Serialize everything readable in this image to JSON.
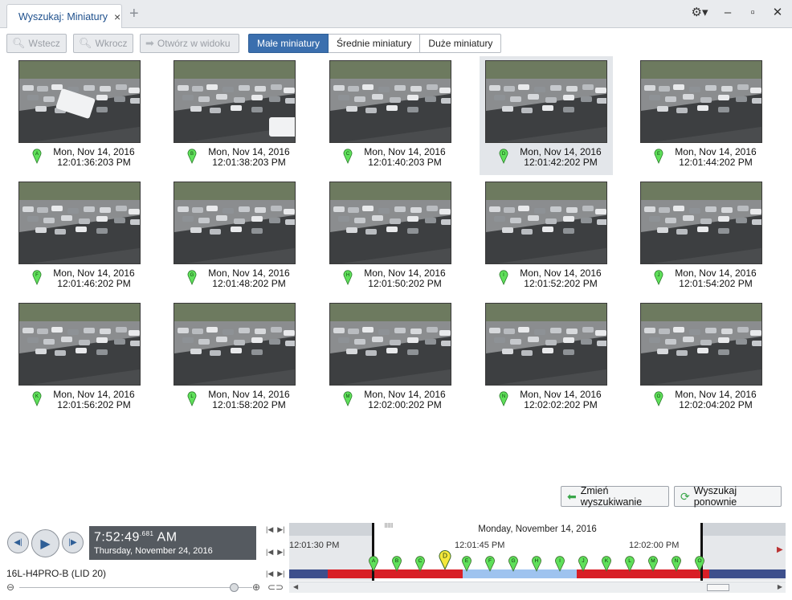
{
  "window": {
    "tab_title": "Wyszukaj: Miniatury",
    "tab_close": "×",
    "tab_add": "+"
  },
  "toolbar": {
    "back_label": "Wstecz",
    "forward_label": "Wkrocz",
    "open_in_view_label": "Otwórz w widoku",
    "size_small": "Małe miniatury",
    "size_medium": "Średnie miniatury",
    "size_large": "Duże miniatury",
    "selected_size": "Małe miniatury"
  },
  "thumbnails": [
    {
      "letter": "A",
      "date": "Mon, Nov 14, 2016",
      "time": "12:01:36:203 PM",
      "selected": false
    },
    {
      "letter": "B",
      "date": "Mon, Nov 14, 2016",
      "time": "12:01:38:203 PM",
      "selected": false
    },
    {
      "letter": "C",
      "date": "Mon, Nov 14, 2016",
      "time": "12:01:40:203 PM",
      "selected": false
    },
    {
      "letter": "D",
      "date": "Mon, Nov 14, 2016",
      "time": "12:01:42:202 PM",
      "selected": true
    },
    {
      "letter": "E",
      "date": "Mon, Nov 14, 2016",
      "time": "12:01:44:202 PM",
      "selected": false
    },
    {
      "letter": "F",
      "date": "Mon, Nov 14, 2016",
      "time": "12:01:46:202 PM",
      "selected": false
    },
    {
      "letter": "G",
      "date": "Mon, Nov 14, 2016",
      "time": "12:01:48:202 PM",
      "selected": false
    },
    {
      "letter": "H",
      "date": "Mon, Nov 14, 2016",
      "time": "12:01:50:202 PM",
      "selected": false
    },
    {
      "letter": "I",
      "date": "Mon, Nov 14, 2016",
      "time": "12:01:52:202 PM",
      "selected": false
    },
    {
      "letter": "J",
      "date": "Mon, Nov 14, 2016",
      "time": "12:01:54:202 PM",
      "selected": false
    },
    {
      "letter": "K",
      "date": "Mon, Nov 14, 2016",
      "time": "12:01:56:202 PM",
      "selected": false
    },
    {
      "letter": "L",
      "date": "Mon, Nov 14, 2016",
      "time": "12:01:58:202 PM",
      "selected": false
    },
    {
      "letter": "M",
      "date": "Mon, Nov 14, 2016",
      "time": "12:02:00:202 PM",
      "selected": false
    },
    {
      "letter": "N",
      "date": "Mon, Nov 14, 2016",
      "time": "12:02:02:202 PM",
      "selected": false
    },
    {
      "letter": "O",
      "date": "Mon, Nov 14, 2016",
      "time": "12:02:04:202 PM",
      "selected": false
    }
  ],
  "actions": {
    "modify_search_label": "Zmień wyszukiwanie",
    "search_again_label": "Wyszukaj ponownie"
  },
  "player": {
    "time_main": "7:52:49",
    "time_ms": ".681",
    "time_ampm": "AM",
    "date_label": "Thursday, November 24, 2016",
    "camera_label": "16L-H4PRO-B (LID 20)"
  },
  "timeline": {
    "date_header": "Monday, November 14, 2016",
    "ticks": [
      "12:01:30 PM",
      "12:01:45 PM",
      "12:02:00 PM"
    ],
    "markers": [
      "A",
      "B",
      "C",
      "D",
      "E",
      "F",
      "G",
      "H",
      "I",
      "J",
      "K",
      "L",
      "M",
      "N",
      "O"
    ],
    "highlighted_marker": "D"
  },
  "colors": {
    "accent": "#3b6fae",
    "marker_green": "#5fe05a",
    "marker_yellow": "#f6e83b",
    "timeline_red": "#d81f26",
    "timeline_blue": "#9ec3ef",
    "timeline_navy": "#3d4f8c"
  }
}
